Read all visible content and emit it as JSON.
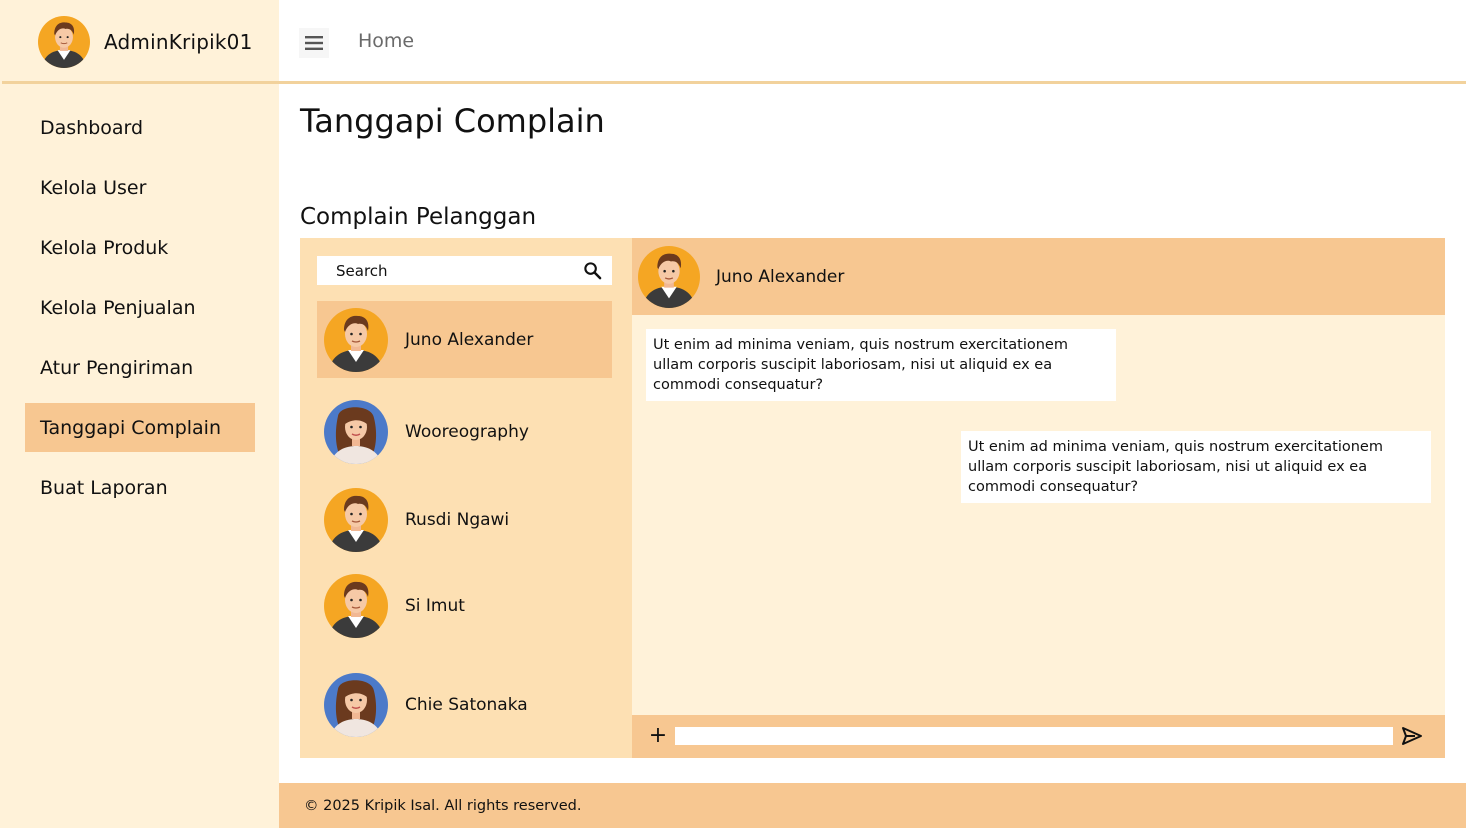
{
  "profile": {
    "username": "AdminKripik01",
    "avatar": "male-avatar"
  },
  "sidebar": {
    "items": [
      {
        "label": "Dashboard"
      },
      {
        "label": "Kelola User"
      },
      {
        "label": "Kelola Produk"
      },
      {
        "label": "Kelola Penjualan"
      },
      {
        "label": "Atur Pengiriman"
      },
      {
        "label": "Tanggapi Complain",
        "active": true
      },
      {
        "label": "Buat Laporan"
      }
    ]
  },
  "topbar": {
    "menu_icon": "hamburger-icon",
    "home_label": "Home"
  },
  "main": {
    "title": "Tanggapi Complain",
    "section_title": "Complain Pelanggan"
  },
  "contacts": {
    "search_placeholder": "Search",
    "search_icon": "search-icon",
    "items": [
      {
        "name": "Juno Alexander",
        "avatar": "male-avatar",
        "active": true
      },
      {
        "name": "Wooreography",
        "avatar": "female-avatar"
      },
      {
        "name": "Rusdi Ngawi",
        "avatar": "male-avatar"
      },
      {
        "name": "Si Imut",
        "avatar": "male-avatar"
      },
      {
        "name": "Chie Satonaka",
        "avatar": "female-avatar"
      }
    ]
  },
  "chat": {
    "header_name": "Juno Alexander",
    "messages": [
      {
        "side": "left",
        "text": "Ut enim ad minima veniam, quis nostrum exercitationem ullam corporis  suscipit laboriosam, nisi ut aliquid ex ea commodi consequatur?"
      },
      {
        "side": "right",
        "text": "Ut enim ad minima veniam, quis nostrum exercitationem ullam corporis  suscipit laboriosam, nisi ut aliquid ex ea commodi consequatur?"
      }
    ],
    "attach_label": "+",
    "send_icon": "send-icon"
  },
  "footer": {
    "text": "© 2025 Kripik Isal. All rights reserved."
  },
  "colors": {
    "sidebar_bg": "#fff2d9",
    "accent": "#f7c791",
    "contacts_bg": "#fde0b3",
    "chat_bg": "#fff2d9"
  }
}
